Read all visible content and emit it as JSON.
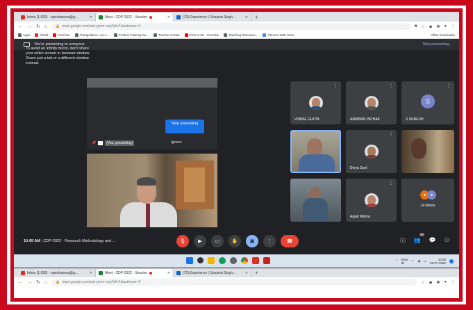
{
  "browser": {
    "tabs": [
      {
        "label": "Inbox (1,099) - rajeshunexa@g...",
        "icon": "gmail-icon",
        "color": "#d93025",
        "active": false
      },
      {
        "label": "Meet - CDP-2022 - Session",
        "icon": "meet-icon",
        "color": "#188038",
        "active": true,
        "recording": true
      },
      {
        "label": "(70) Experience | Sunaina Singh...",
        "icon": "linkedin-icon",
        "color": "#0a66c2",
        "active": false
      }
    ],
    "new_tab": "+",
    "url": "meet.google.com/sak-yjmm-npq?pli=1&authuser=2",
    "bookmarks": [
      {
        "label": "Apps",
        "color": "#5f6368"
      },
      {
        "label": "Gmail",
        "color": "#d93025"
      },
      {
        "label": "YouTube",
        "color": "#ff0000"
      },
      {
        "label": "Triangulation | an o...",
        "color": "#5f6368"
      },
      {
        "label": "Product Training Ov...",
        "color": "#5f6368"
      },
      {
        "label": "Teacher Center",
        "color": "#5f6368"
      },
      {
        "label": "ECO in 60 - YouTube",
        "color": "#ff0000"
      },
      {
        "label": "Teaching Resource...",
        "color": "#5f6368"
      },
      {
        "label": "Chrome Web Store",
        "color": "#4285f4"
      }
    ],
    "other_bookmarks": "Other bookmarks"
  },
  "presenting_bar": {
    "message": "You're presenting to everyone",
    "stop_label": "Stop presenting"
  },
  "presentation": {
    "mirror_warning": "To avoid an infinity mirror, don't share your entire screen or browser window. Share just a tab or a different window instead.",
    "stop_button": "Stop presenting",
    "ignore_label": "Ignore",
    "presenter_label": "(You, presenting)"
  },
  "participants": [
    {
      "name": "VISHAL GUPTA",
      "kind": "photo"
    },
    {
      "name": "ANIRBAN PATHAK",
      "kind": "photo"
    },
    {
      "name": "S SURESH",
      "kind": "initial",
      "initial": "S"
    },
    {
      "name": "",
      "kind": "video"
    },
    {
      "name": "Divya Goel",
      "kind": "photo"
    },
    {
      "name": "",
      "kind": "video"
    },
    {
      "name": "",
      "kind": "video"
    },
    {
      "name": "Anjali Mishra",
      "kind": "photo"
    },
    {
      "name": "14 others",
      "kind": "others"
    }
  ],
  "meeting": {
    "time": "10:05 AM",
    "separator": "|",
    "title": "CDP-2022 - Research Methodology and ...",
    "participant_count": "20"
  },
  "taskbar": {
    "lang": "ENG\nIN",
    "time": "10:05",
    "date": "26-07-2022"
  },
  "colors": {
    "frame_red": "#c8081c",
    "meet_bg": "#202124",
    "tile_bg": "#3c4043",
    "accent_blue": "#1a73e8",
    "end_call_red": "#ea4335"
  }
}
